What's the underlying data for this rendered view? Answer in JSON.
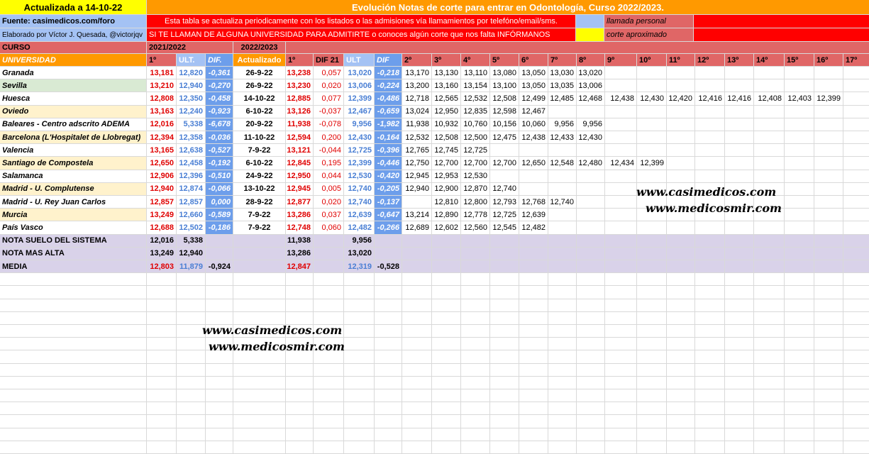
{
  "header": {
    "updated": "Actualizada a 14-10-22",
    "title": "Evolución Notas de corte para entrar en Odontología, Curso 2022/2023.",
    "source": "Fuente: casimedicos.com/foro",
    "note": "Esta tabla se actualiza periodicamente con los listados o las admisiones vía llamamientos por telefóno/email/sms.",
    "legend_personal": "llamada personal",
    "author": "Elaborado por Víctor J. Quesada, @victorjqv",
    "call_to_action": "SI TE LLAMAN DE ALGUNA UNIVERSIDAD PARA ADMITIRTE o conoces algún corte que nos falta INFÓRMANOS",
    "legend_approx": "corte aproximado"
  },
  "labels": {
    "curso": "CURSO",
    "year_prev": "2021/2022",
    "year_cur": "2022/2023",
    "universidad": "UNIVERSIDAD",
    "h_1": "1º",
    "h_ult": "ULT.",
    "h_dif": "DIF.",
    "h_act": "Actualizado",
    "h_1b": "1º",
    "h_dif21": "DIF 21",
    "h_ult2": "ULT",
    "h_dif2": "DIF",
    "rounds": [
      "2º",
      "3º",
      "4º",
      "5º",
      "6º",
      "7º",
      "8º",
      "9º",
      "10º",
      "11º",
      "12º",
      "13º",
      "14º",
      "15º",
      "16º",
      "17º"
    ]
  },
  "rows": [
    {
      "name": "Granada",
      "p1": "13,181",
      "pu": "12,820",
      "pd": "-0,361",
      "act": "26-9-22",
      "c1": "13,238",
      "d21": "0,057",
      "cu": "13,020",
      "cd": "-0,218",
      "r": [
        "13,170",
        "13,130",
        "13,110",
        "13,080",
        "13,050",
        "13,030",
        "13,020"
      ]
    },
    {
      "name": "Sevilla",
      "p1": "13,210",
      "pu": "12,940",
      "pd": "-0,270",
      "act": "26-9-22",
      "c1": "13,230",
      "d21": "0,020",
      "cu": "13,006",
      "cd": "-0,224",
      "r": [
        "13,200",
        "13,160",
        "13,154",
        "13,100",
        "13,050",
        "13,035",
        "13,006"
      ]
    },
    {
      "name": "Huesca",
      "p1": "12,808",
      "pu": "12,350",
      "pd": "-0,458",
      "act": "14-10-22",
      "c1": "12,885",
      "d21": "0,077",
      "cu": "12,399",
      "cd": "-0,486",
      "r": [
        "12,718",
        "12,565",
        "12,532",
        "12,508",
        "12,499",
        "12,485",
        "12,468",
        "12,438",
        "12,430",
        "12,420",
        "12,416",
        "12,416",
        "12,408",
        "12,403",
        "12,399"
      ]
    },
    {
      "name": "Oviedo",
      "p1": "13,163",
      "pu": "12,240",
      "pd": "-0,923",
      "act": "6-10-22",
      "c1": "13,126",
      "d21": "-0,037",
      "cu": "12,467",
      "cd": "-0,659",
      "r": [
        "13,024",
        "12,950",
        "12,835",
        "12,598",
        "12,467"
      ]
    },
    {
      "name": "Baleares - Centro adscrito ADEMA",
      "p1": "12,016",
      "pu": "5,338",
      "pd": "-6,678",
      "act": "20-9-22",
      "c1": "11,938",
      "d21": "-0,078",
      "cu": "9,956",
      "cd": "-1,982",
      "r": [
        "11,938",
        "10,932",
        "10,760",
        "10,156",
        "10,060",
        "9,956",
        "9,956"
      ]
    },
    {
      "name": "Barcelona (L'Hospitalet de Llobregat)",
      "p1": "12,394",
      "pu": "12,358",
      "pd": "-0,036",
      "act": "11-10-22",
      "c1": "12,594",
      "d21": "0,200",
      "cu": "12,430",
      "cd": "-0,164",
      "r": [
        "12,532",
        "12,508",
        "12,500",
        "12,475",
        "12,438",
        "12,433",
        "12,430"
      ]
    },
    {
      "name": "Valencia",
      "p1": "13,165",
      "pu": "12,638",
      "pd": "-0,527",
      "act": "7-9-22",
      "c1": "13,121",
      "d21": "-0,044",
      "cu": "12,725",
      "cd": "-0,396",
      "r": [
        "12,765",
        "12,745",
        "12,725"
      ]
    },
    {
      "name": "Santiago de Compostela",
      "p1": "12,650",
      "pu": "12,458",
      "pd": "-0,192",
      "act": "6-10-22",
      "c1": "12,845",
      "d21": "0,195",
      "cu": "12,399",
      "cd": "-0,446",
      "r": [
        "12,750",
        "12,700",
        "12,700",
        "12,700",
        "12,650",
        "12,548",
        "12,480",
        "12,434",
        "12,399"
      ]
    },
    {
      "name": "Salamanca",
      "p1": "12,906",
      "pu": "12,396",
      "pd": "-0,510",
      "act": "24-9-22",
      "c1": "12,950",
      "d21": "0,044",
      "cu": "12,530",
      "cd": "-0,420",
      "r": [
        "12,945",
        "12,953",
        "12,530"
      ]
    },
    {
      "name": "Madrid - U. Complutense",
      "p1": "12,940",
      "pu": "12,874",
      "pd": "-0,066",
      "act": "13-10-22",
      "c1": "12,945",
      "d21": "0,005",
      "cu": "12,740",
      "cd": "-0,205",
      "r": [
        "12,940",
        "12,900",
        "12,870",
        "12,740"
      ]
    },
    {
      "name": "Madrid - U. Rey Juan Carlos",
      "p1": "12,857",
      "pu": "12,857",
      "pd": "0,000",
      "act": "28-9-22",
      "c1": "12,877",
      "d21": "0,020",
      "cu": "12,740",
      "cd": "-0,137",
      "r": [
        "",
        "12,810",
        "12,800",
        "12,793",
        "12,768",
        "12,740"
      ]
    },
    {
      "name": "Murcia",
      "p1": "13,249",
      "pu": "12,660",
      "pd": "-0,589",
      "act": "7-9-22",
      "c1": "13,286",
      "d21": "0,037",
      "cu": "12,639",
      "cd": "-0,647",
      "r": [
        "13,214",
        "12,890",
        "12,778",
        "12,725",
        "12,639"
      ]
    },
    {
      "name": "País Vasco",
      "p1": "12,688",
      "pu": "12,502",
      "pd": "-0,186",
      "act": "7-9-22",
      "c1": "12,748",
      "d21": "0,060",
      "cu": "12,482",
      "cd": "-0,266",
      "r": [
        "12,689",
        "12,602",
        "12,560",
        "12,545",
        "12,482"
      ]
    }
  ],
  "summary": [
    {
      "label": "NOTA SUELO DEL SISTEMA",
      "p1": "12,016",
      "pu": "5,338",
      "pd": "",
      "c1": "11,938",
      "cu": "9,956",
      "cd": ""
    },
    {
      "label": "NOTA MAS ALTA",
      "p1": "13,249",
      "pu": "12,940",
      "pd": "",
      "c1": "13,286",
      "cu": "13,020",
      "cd": ""
    },
    {
      "label": "MEDIA",
      "p1": "12,803",
      "pu": "11,879",
      "pd": "-0,924",
      "c1": "12,847",
      "cu": "12,319",
      "cd": "-0,528"
    }
  ],
  "watermarks": [
    "www.casimedicos.com",
    "www.medicosmir.com"
  ],
  "colors": {
    "red": "#ff0000",
    "orange": "#ff9900",
    "yellow": "#ffff00",
    "salmon": "#e06666",
    "lightblue": "#a4c2f4",
    "blue": "#6d9eeb",
    "lavender": "#d9d2e9",
    "cream": "#fff2cc",
    "green": "#d9ead3"
  }
}
